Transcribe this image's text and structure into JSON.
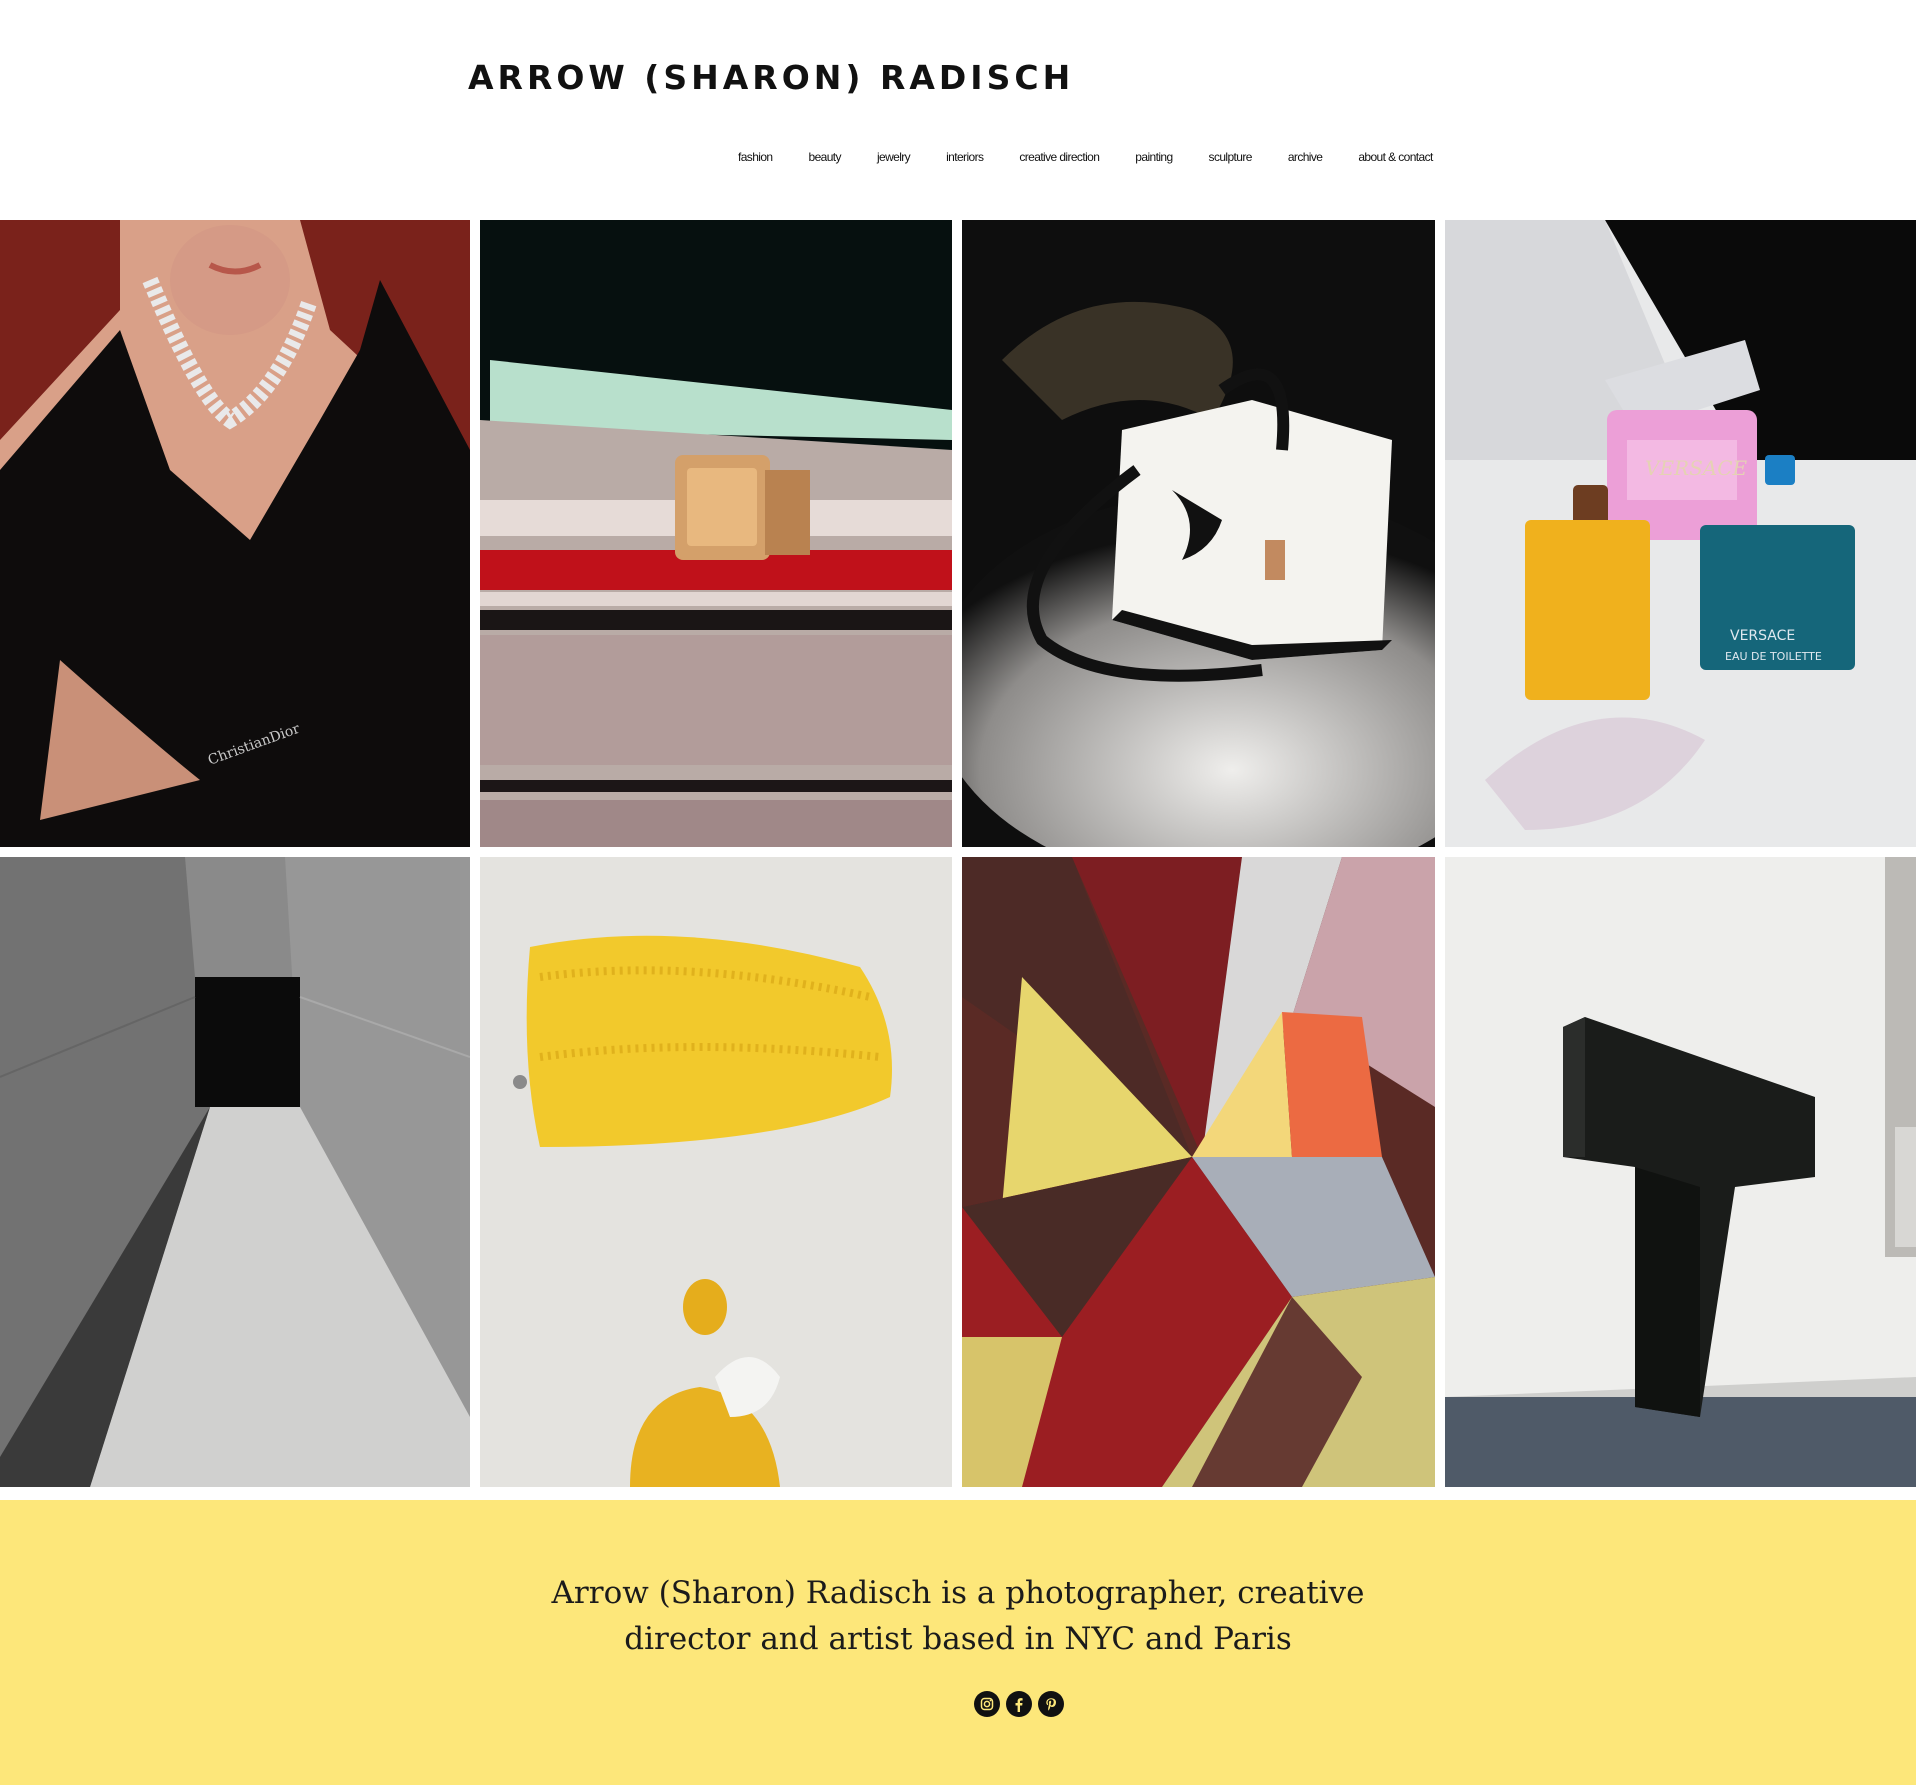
{
  "header": {
    "title": "ARROW (SHARON) RADISCH"
  },
  "nav": {
    "items": [
      {
        "label": "fashion"
      },
      {
        "label": "beauty"
      },
      {
        "label": "jewelry"
      },
      {
        "label": "interiors"
      },
      {
        "label": "creative direction"
      },
      {
        "label": "painting"
      },
      {
        "label": "sculpture"
      },
      {
        "label": "archive"
      },
      {
        "label": "about & contact"
      }
    ]
  },
  "gallery": {
    "tiles": [
      {
        "subject": "model-necklace"
      },
      {
        "subject": "gold-watch-on-books"
      },
      {
        "subject": "white-handbag"
      },
      {
        "subject": "versace-perfumes"
      },
      {
        "subject": "concrete-corridor"
      },
      {
        "subject": "yellow-fuzzy-pouch"
      },
      {
        "subject": "geometric-painting"
      },
      {
        "subject": "black-sculpture"
      }
    ]
  },
  "footer": {
    "tagline_line1": "Arrow (Sharon) Radisch is a photographer, creative",
    "tagline_line2": "director and artist based in NYC and Paris",
    "background_color": "#fde77a",
    "social": [
      "instagram-icon",
      "facebook-icon",
      "pinterest-icon"
    ]
  }
}
